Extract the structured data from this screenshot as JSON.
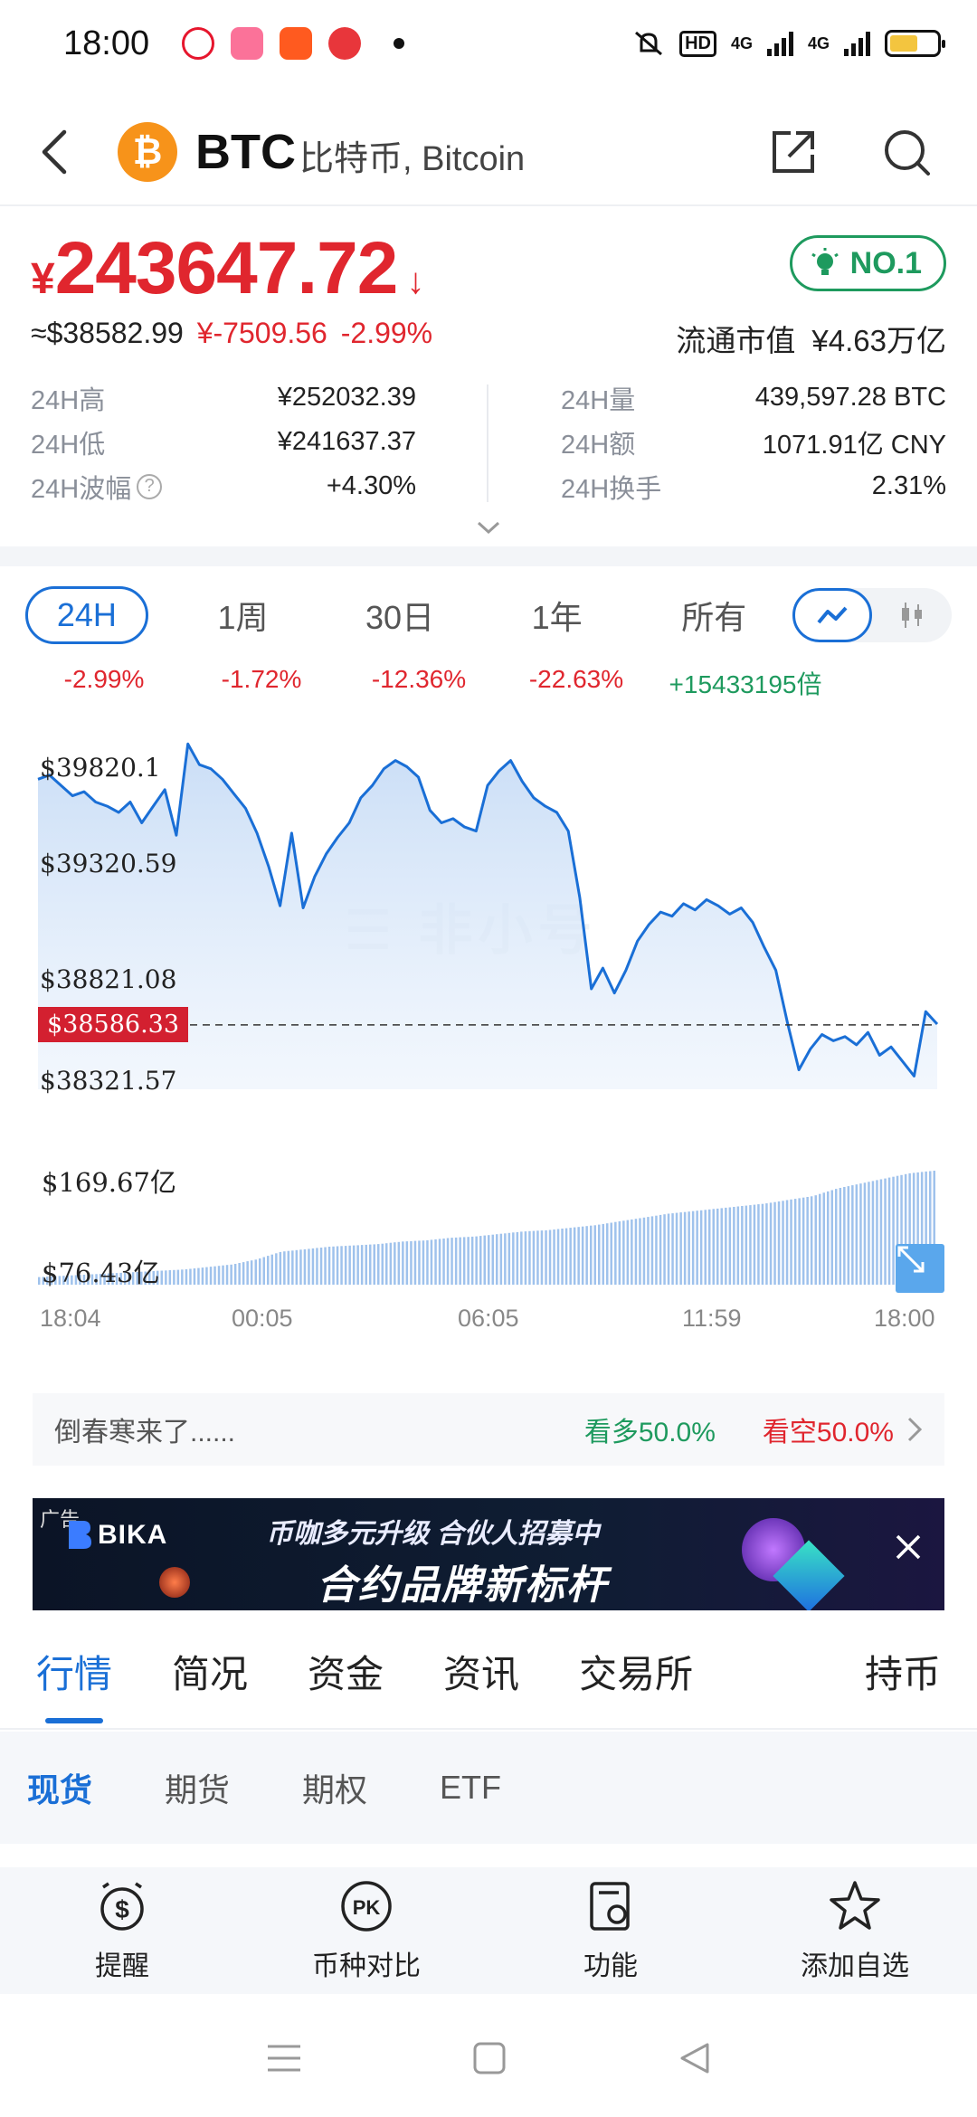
{
  "status": {
    "time": "18:00",
    "hd_label": "HD",
    "net1": "4G",
    "net2": "4G",
    "battery_level": 0.6
  },
  "header": {
    "coin_logo": "₿",
    "symbol": "BTC",
    "name": "比特币, Bitcoin"
  },
  "price": {
    "currency": "¥",
    "value": "243647.72",
    "direction_icon": "↓",
    "usd": "≈$38582.99",
    "change_cny": "¥-7509.56",
    "change_pct": "-2.99%",
    "rank": "NO.1",
    "market_cap_label": "流通市值",
    "market_cap_value": "¥4.63万亿"
  },
  "stats": {
    "left": [
      {
        "k": "24H高",
        "v": "¥252032.39"
      },
      {
        "k": "24H低",
        "v": "¥241637.37"
      },
      {
        "k": "24H波幅",
        "v": "+4.30%"
      }
    ],
    "right": [
      {
        "k": "24H量",
        "v": "439,597.28 BTC"
      },
      {
        "k": "24H额",
        "v": "1071.91亿 CNY"
      },
      {
        "k": "24H换手",
        "v": "2.31%"
      }
    ]
  },
  "ranges": {
    "tabs": [
      "24H",
      "1周",
      "30日",
      "1年",
      "所有"
    ],
    "changes": [
      "-2.99%",
      "-1.72%",
      "-12.36%",
      "-22.63%",
      "+15433195倍"
    ]
  },
  "chart_data": {
    "type": "line",
    "y_ticks": [
      "$39820.1",
      "$39320.59",
      "$38821.08",
      "$38321.57"
    ],
    "current_price_tag": "$38586.33",
    "volume_ticks": [
      "$169.67亿",
      "$76.43亿"
    ],
    "x_ticks": [
      "18:04",
      "00:05",
      "06:05",
      "11:59",
      "18:00"
    ],
    "ylim": [
      38250,
      39950
    ],
    "line_color": "#1a6fd6",
    "series": [
      {
        "values": [
          39770,
          39790,
          39740,
          39690,
          39710,
          39660,
          39640,
          39610,
          39660,
          39560,
          39640,
          39720,
          39500,
          39940,
          39840,
          39820,
          39770,
          39700,
          39630,
          39510,
          39350,
          39160,
          39510,
          39150,
          39300,
          39410,
          39490,
          39560,
          39680,
          39740,
          39820,
          39860,
          39830,
          39780,
          39620,
          39560,
          39580,
          39540,
          39520,
          39740,
          39810,
          39860,
          39760,
          39680,
          39640,
          39610,
          39520,
          39200,
          38760,
          38860,
          38740,
          38850,
          38990,
          39070,
          39130,
          39110,
          39170,
          39140,
          39190,
          39160,
          39120,
          39150,
          39080,
          38960,
          38850,
          38600,
          38370,
          38470,
          38540,
          38510,
          38530,
          38490,
          38550,
          38440,
          38480,
          38410,
          38340,
          38650,
          38590
        ]
      }
    ],
    "volume_profile": [
      0.06,
      0.07,
      0.08,
      0.09,
      0.1,
      0.11,
      0.12,
      0.14,
      0.16,
      0.2,
      0.26,
      0.28,
      0.3,
      0.31,
      0.32,
      0.34,
      0.35,
      0.37,
      0.38,
      0.4,
      0.42,
      0.43,
      0.45,
      0.47,
      0.5,
      0.53,
      0.56,
      0.58,
      0.6,
      0.62,
      0.64,
      0.67,
      0.7,
      0.76,
      0.8,
      0.84,
      0.88,
      0.9
    ]
  },
  "sentiment": {
    "text": "倒春寒来了......",
    "bull": "看多50.0%",
    "bear": "看空50.0%"
  },
  "ad": {
    "tag": "广告",
    "brand": "BIKA",
    "line1": "币咖多元升级  合伙人招募中",
    "line2": "合约品牌新标杆"
  },
  "main_tabs": [
    "行情",
    "简况",
    "资金",
    "资讯",
    "交易所",
    "持币"
  ],
  "sub_tabs": [
    "现货",
    "期货",
    "期权",
    "ETF"
  ],
  "actions": [
    {
      "label": "提醒",
      "icon": "alarm-dollar-icon"
    },
    {
      "label": "币种对比",
      "icon": "pk-icon"
    },
    {
      "label": "功能",
      "icon": "function-icon"
    },
    {
      "label": "添加自选",
      "icon": "star-icon"
    }
  ],
  "colors": {
    "accent": "#1a6fd6",
    "down": "#e0262e",
    "up": "#1e9a5e",
    "coin": "#f7931a"
  }
}
